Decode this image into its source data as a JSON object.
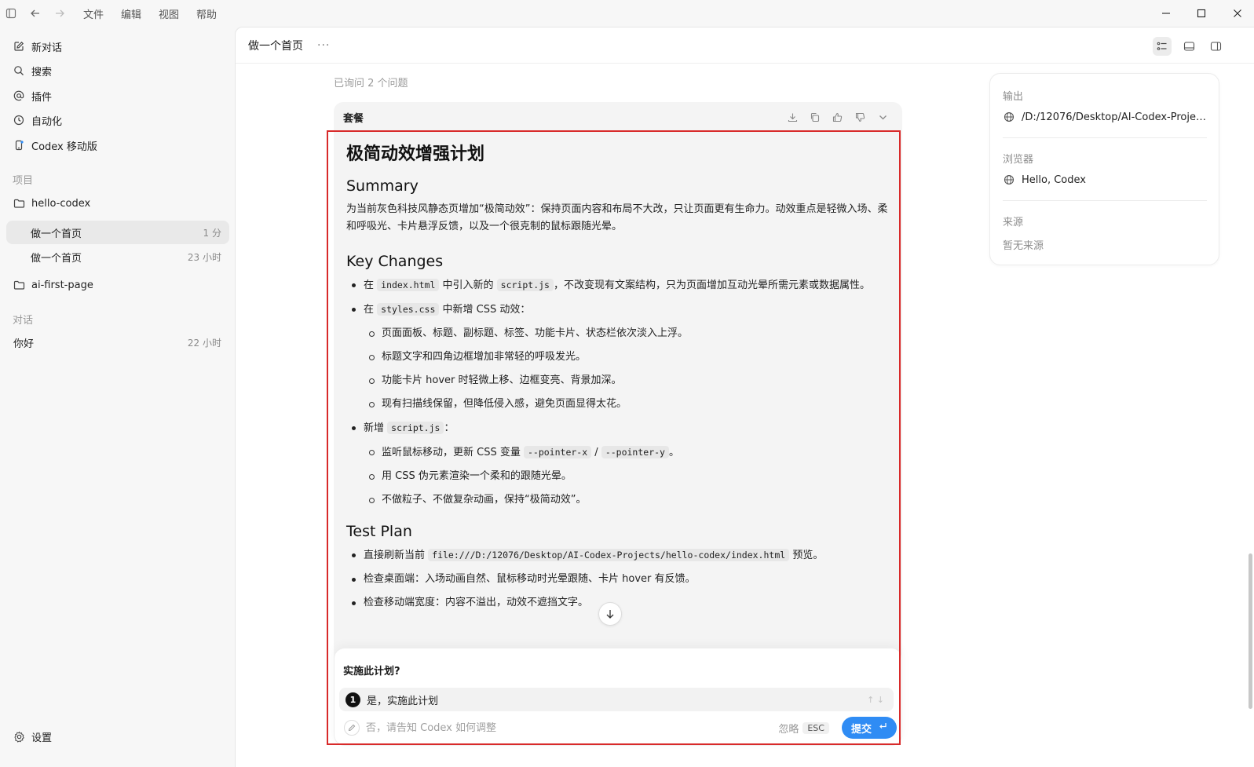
{
  "titlebar": {
    "menus": [
      "文件",
      "编辑",
      "视图",
      "帮助"
    ]
  },
  "sidebar": {
    "nav": [
      {
        "label": "新对话",
        "icon": "edit-icon"
      },
      {
        "label": "搜索",
        "icon": "search-icon"
      },
      {
        "label": "插件",
        "icon": "at-icon"
      },
      {
        "label": "自动化",
        "icon": "clock-icon"
      },
      {
        "label": "Codex 移动版",
        "icon": "mobile-icon"
      }
    ],
    "projects_label": "项目",
    "projects": [
      {
        "name": "hello-codex",
        "threads": [
          {
            "title": "做一个首页",
            "time": "1 分"
          },
          {
            "title": "做一个首页",
            "time": "23 小时"
          }
        ]
      },
      {
        "name": "ai-first-page",
        "threads": []
      }
    ],
    "chats_label": "对话",
    "chats": [
      {
        "title": "你好",
        "time": "22 小时"
      }
    ],
    "settings": "设置"
  },
  "header": {
    "title": "做一个首页",
    "more": "···"
  },
  "conversation": {
    "asked": "已询问 2 个问题"
  },
  "plan": {
    "card_title": "套餐",
    "h1": "极简动效增强计划",
    "summary_heading": "Summary",
    "summary_text": "为当前灰色科技风静态页增加“极简动效”：保持页面内容和布局不大改，只让页面更有生命力。动效重点是轻微入场、柔和呼吸光、卡片悬浮反馈，以及一个很克制的鼠标跟随光晕。",
    "key_heading": "Key Changes",
    "kc1_a": "在 ",
    "kc1_code1": "index.html",
    "kc1_b": " 中引入新的 ",
    "kc1_code2": "script.js",
    "kc1_c": "，不改变现有文案结构，只为页面增加互动光晕所需元素或数据属性。",
    "kc2_a": "在 ",
    "kc2_code": "styles.css",
    "kc2_b": " 中新增 CSS 动效：",
    "kc2_sub": [
      "页面面板、标题、副标题、标签、功能卡片、状态栏依次淡入上浮。",
      "标题文字和四角边框增加非常轻的呼吸发光。",
      "功能卡片 hover 时轻微上移、边框变亮、背景加深。",
      "现有扫描线保留，但降低侵入感，避免页面显得太花。"
    ],
    "kc3_a": "新增 ",
    "kc3_code": "script.js",
    "kc3_b": "：",
    "kc3_sub1_a": "监听鼠标移动，更新 CSS 变量 ",
    "kc3_sub1_code1": "--pointer-x",
    "kc3_sub1_sep": " / ",
    "kc3_sub1_code2": "--pointer-y",
    "kc3_sub1_b": "。",
    "kc3_sub2": "用 CSS 伪元素渲染一个柔和的跟随光晕。",
    "kc3_sub3": "不做粒子、不做复杂动画，保持“极简动效”。",
    "test_heading": "Test Plan",
    "tp1_a": "直接刷新当前 ",
    "tp1_code": "file:///D:/12076/Desktop/AI-Codex-Projects/hello-codex/index.html",
    "tp1_b": " 预览。",
    "tp2": "检查桌面端：入场动画自然、鼠标移动时光晕跟随、卡片 hover 有反馈。",
    "tp3": "检查移动端宽度：内容不溢出，动效不遮挡文字。"
  },
  "question": {
    "title": "实施此计划?",
    "option1_num": "1",
    "option1": "是，实施此计划",
    "option2_placeholder": "否，请告知 Codex 如何调整",
    "ignore": "忽略",
    "esc": "ESC",
    "submit": "提交"
  },
  "side_panel": {
    "output_label": "输出",
    "output_path": "/D:/12076/Desktop/AI-Codex-Project...",
    "browser_label": "浏览器",
    "browser_value": "Hello, Codex",
    "source_label": "来源",
    "source_value": "暂无来源"
  },
  "colors": {
    "accent": "#2f8cf4",
    "highlight": "#d82a2a",
    "sidebar_bg": "#f7f7f7",
    "selected_bg": "#e9e9e9"
  }
}
